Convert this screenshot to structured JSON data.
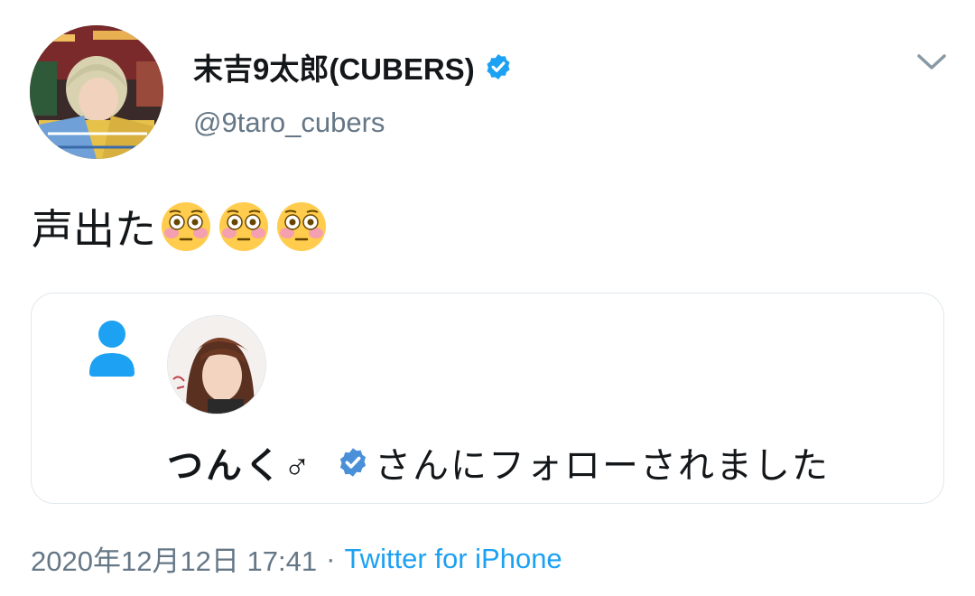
{
  "author": {
    "display_name": "末吉9太郎(CUBERS)",
    "handle": "@9taro_cubers"
  },
  "tweet": {
    "text": "声出た",
    "emoji_count": 3,
    "emoji_name": "flushed-face"
  },
  "card": {
    "follower_name": "つんく♂",
    "follow_text": "さんにフォローされました"
  },
  "footer": {
    "timestamp": "2020年12月12日 17:41",
    "separator": "·",
    "source": "Twitter for iPhone"
  },
  "colors": {
    "verified_blue": "#1da1f2",
    "text_primary": "#14171a",
    "text_secondary": "#657786",
    "person_icon_blue": "#1da1f2"
  }
}
